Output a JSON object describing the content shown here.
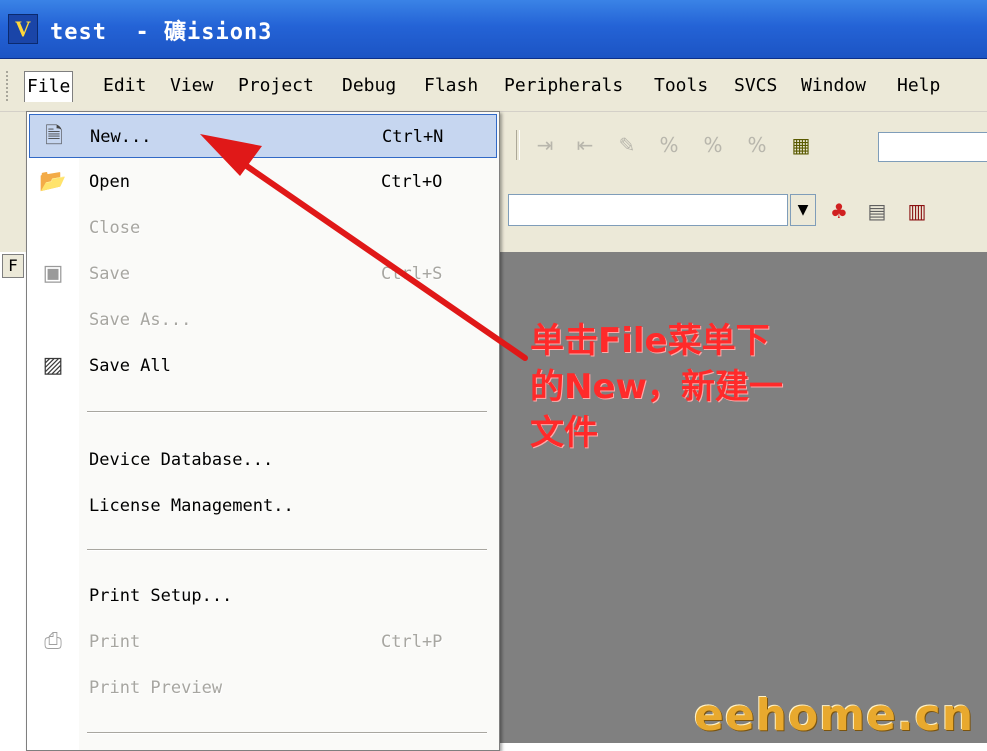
{
  "window": {
    "title": "test  - 礦ision3",
    "app_icon": "uvision-icon"
  },
  "menubar": {
    "items": [
      "File",
      "Edit",
      "View",
      "Project",
      "Debug",
      "Flash",
      "Peripherals",
      "Tools",
      "SVCS",
      "Window",
      "Help"
    ],
    "active": "File"
  },
  "left_pane": {
    "tab_label": "F"
  },
  "file_menu": {
    "new": {
      "label": "New...",
      "shortcut": "Ctrl+N",
      "icon": "new-file-icon"
    },
    "open": {
      "label": "Open",
      "shortcut": "Ctrl+O",
      "icon": "open-folder-icon"
    },
    "close": {
      "label": "Close"
    },
    "save": {
      "label": "Save",
      "shortcut": "Ctrl+S",
      "icon": "save-icon"
    },
    "save_as": {
      "label": "Save As..."
    },
    "save_all": {
      "label": "Save All",
      "icon": "save-all-icon"
    },
    "device_database": {
      "label": "Device Database..."
    },
    "license_management": {
      "label": "License Management.."
    },
    "print_setup": {
      "label": "Print Setup..."
    },
    "print": {
      "label": "Print",
      "shortcut": "Ctrl+P",
      "icon": "printer-icon"
    },
    "print_preview": {
      "label": "Print Preview"
    }
  },
  "annotation": {
    "line1": "单击File菜单下",
    "line2": "的New，新建一",
    "line3": "文件",
    "color": "#ff2a2a"
  },
  "watermark": {
    "text": "eehome.cn"
  },
  "toolbar": {
    "row1_icons": [
      "indent-icon",
      "unindent-icon",
      "bookmark-icon",
      "bookmark-next-icon",
      "bookmark-prev-icon",
      "bookmark-clear-icon",
      "find-in-files-icon"
    ],
    "row2_icons": [
      "project-window-icon",
      "window-layout-icon",
      "peripheral-icon"
    ]
  }
}
